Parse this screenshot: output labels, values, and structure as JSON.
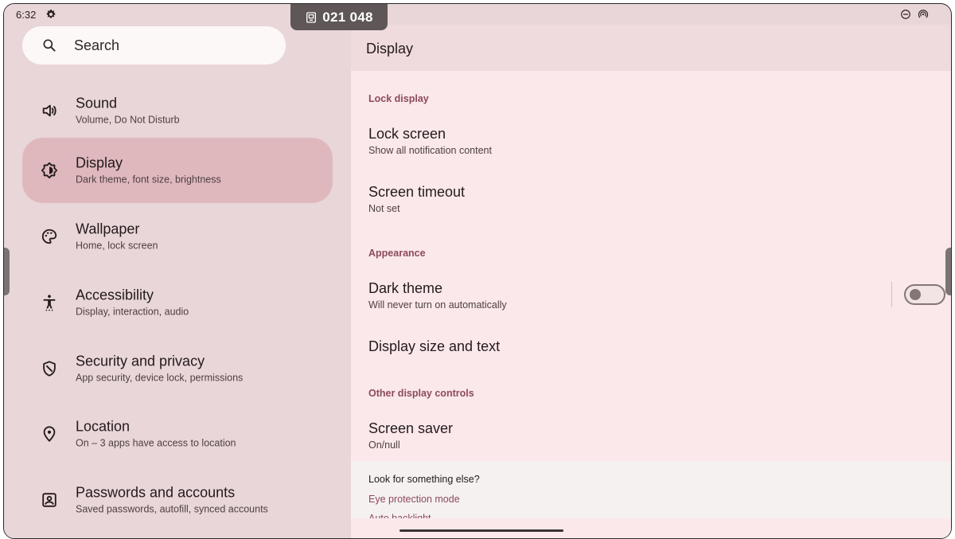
{
  "status_bar": {
    "time": "6:32",
    "code": "021 048"
  },
  "search": {
    "placeholder": "Search"
  },
  "nav": [
    {
      "title": "Sound",
      "subtitle": "Volume, Do Not Disturb",
      "icon": "volume-icon"
    },
    {
      "title": "Display",
      "subtitle": "Dark theme, font size, brightness",
      "icon": "brightness-icon",
      "active": true
    },
    {
      "title": "Wallpaper",
      "subtitle": "Home, lock screen",
      "icon": "palette-icon"
    },
    {
      "title": "Accessibility",
      "subtitle": "Display, interaction, audio",
      "icon": "accessibility-icon"
    },
    {
      "title": "Security and privacy",
      "subtitle": "App security, device lock, permissions",
      "icon": "shield-icon"
    },
    {
      "title": "Location",
      "subtitle": "On – 3 apps have access to location",
      "icon": "location-pin-icon"
    },
    {
      "title": "Passwords and accounts",
      "subtitle": "Saved passwords, autofill, synced accounts",
      "icon": "account-box-icon"
    }
  ],
  "page": {
    "title": "Display",
    "sections": {
      "lock_display": "Lock display",
      "appearance": "Appearance",
      "other": "Other display controls"
    },
    "settings": {
      "lock_screen": {
        "title": "Lock screen",
        "subtitle": "Show all notification content"
      },
      "screen_timeout": {
        "title": "Screen timeout",
        "subtitle": "Not set"
      },
      "dark_theme": {
        "title": "Dark theme",
        "subtitle": "Will never turn on automatically",
        "enabled": false
      },
      "display_size": {
        "title": "Display size and text"
      },
      "screen_saver": {
        "title": "Screen saver",
        "subtitle": "On/null"
      }
    },
    "look_for": {
      "title": "Look for something else?",
      "links": [
        "Eye protection mode",
        "Auto backlight"
      ]
    }
  },
  "colors": {
    "accent": "#8c4a5a",
    "active_bg": "#dfb8bd",
    "panel_bg": "#fbe8ea"
  }
}
